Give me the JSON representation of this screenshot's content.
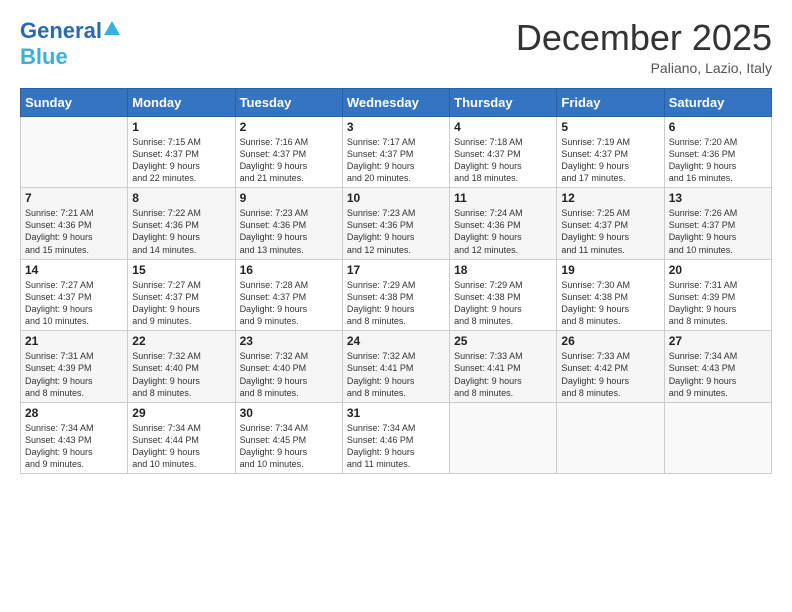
{
  "header": {
    "logo_line1": "General",
    "logo_line2": "Blue",
    "month_title": "December 2025",
    "location": "Paliano, Lazio, Italy"
  },
  "calendar": {
    "days_of_week": [
      "Sunday",
      "Monday",
      "Tuesday",
      "Wednesday",
      "Thursday",
      "Friday",
      "Saturday"
    ],
    "weeks": [
      [
        {
          "day": "",
          "info": ""
        },
        {
          "day": "1",
          "info": "Sunrise: 7:15 AM\nSunset: 4:37 PM\nDaylight: 9 hours\nand 22 minutes."
        },
        {
          "day": "2",
          "info": "Sunrise: 7:16 AM\nSunset: 4:37 PM\nDaylight: 9 hours\nand 21 minutes."
        },
        {
          "day": "3",
          "info": "Sunrise: 7:17 AM\nSunset: 4:37 PM\nDaylight: 9 hours\nand 20 minutes."
        },
        {
          "day": "4",
          "info": "Sunrise: 7:18 AM\nSunset: 4:37 PM\nDaylight: 9 hours\nand 18 minutes."
        },
        {
          "day": "5",
          "info": "Sunrise: 7:19 AM\nSunset: 4:37 PM\nDaylight: 9 hours\nand 17 minutes."
        },
        {
          "day": "6",
          "info": "Sunrise: 7:20 AM\nSunset: 4:36 PM\nDaylight: 9 hours\nand 16 minutes."
        }
      ],
      [
        {
          "day": "7",
          "info": "Sunrise: 7:21 AM\nSunset: 4:36 PM\nDaylight: 9 hours\nand 15 minutes."
        },
        {
          "day": "8",
          "info": "Sunrise: 7:22 AM\nSunset: 4:36 PM\nDaylight: 9 hours\nand 14 minutes."
        },
        {
          "day": "9",
          "info": "Sunrise: 7:23 AM\nSunset: 4:36 PM\nDaylight: 9 hours\nand 13 minutes."
        },
        {
          "day": "10",
          "info": "Sunrise: 7:23 AM\nSunset: 4:36 PM\nDaylight: 9 hours\nand 12 minutes."
        },
        {
          "day": "11",
          "info": "Sunrise: 7:24 AM\nSunset: 4:36 PM\nDaylight: 9 hours\nand 12 minutes."
        },
        {
          "day": "12",
          "info": "Sunrise: 7:25 AM\nSunset: 4:37 PM\nDaylight: 9 hours\nand 11 minutes."
        },
        {
          "day": "13",
          "info": "Sunrise: 7:26 AM\nSunset: 4:37 PM\nDaylight: 9 hours\nand 10 minutes."
        }
      ],
      [
        {
          "day": "14",
          "info": "Sunrise: 7:27 AM\nSunset: 4:37 PM\nDaylight: 9 hours\nand 10 minutes."
        },
        {
          "day": "15",
          "info": "Sunrise: 7:27 AM\nSunset: 4:37 PM\nDaylight: 9 hours\nand 9 minutes."
        },
        {
          "day": "16",
          "info": "Sunrise: 7:28 AM\nSunset: 4:37 PM\nDaylight: 9 hours\nand 9 minutes."
        },
        {
          "day": "17",
          "info": "Sunrise: 7:29 AM\nSunset: 4:38 PM\nDaylight: 9 hours\nand 8 minutes."
        },
        {
          "day": "18",
          "info": "Sunrise: 7:29 AM\nSunset: 4:38 PM\nDaylight: 9 hours\nand 8 minutes."
        },
        {
          "day": "19",
          "info": "Sunrise: 7:30 AM\nSunset: 4:38 PM\nDaylight: 9 hours\nand 8 minutes."
        },
        {
          "day": "20",
          "info": "Sunrise: 7:31 AM\nSunset: 4:39 PM\nDaylight: 9 hours\nand 8 minutes."
        }
      ],
      [
        {
          "day": "21",
          "info": "Sunrise: 7:31 AM\nSunset: 4:39 PM\nDaylight: 9 hours\nand 8 minutes."
        },
        {
          "day": "22",
          "info": "Sunrise: 7:32 AM\nSunset: 4:40 PM\nDaylight: 9 hours\nand 8 minutes."
        },
        {
          "day": "23",
          "info": "Sunrise: 7:32 AM\nSunset: 4:40 PM\nDaylight: 9 hours\nand 8 minutes."
        },
        {
          "day": "24",
          "info": "Sunrise: 7:32 AM\nSunset: 4:41 PM\nDaylight: 9 hours\nand 8 minutes."
        },
        {
          "day": "25",
          "info": "Sunrise: 7:33 AM\nSunset: 4:41 PM\nDaylight: 9 hours\nand 8 minutes."
        },
        {
          "day": "26",
          "info": "Sunrise: 7:33 AM\nSunset: 4:42 PM\nDaylight: 9 hours\nand 8 minutes."
        },
        {
          "day": "27",
          "info": "Sunrise: 7:34 AM\nSunset: 4:43 PM\nDaylight: 9 hours\nand 9 minutes."
        }
      ],
      [
        {
          "day": "28",
          "info": "Sunrise: 7:34 AM\nSunset: 4:43 PM\nDaylight: 9 hours\nand 9 minutes."
        },
        {
          "day": "29",
          "info": "Sunrise: 7:34 AM\nSunset: 4:44 PM\nDaylight: 9 hours\nand 10 minutes."
        },
        {
          "day": "30",
          "info": "Sunrise: 7:34 AM\nSunset: 4:45 PM\nDaylight: 9 hours\nand 10 minutes."
        },
        {
          "day": "31",
          "info": "Sunrise: 7:34 AM\nSunset: 4:46 PM\nDaylight: 9 hours\nand 11 minutes."
        },
        {
          "day": "",
          "info": ""
        },
        {
          "day": "",
          "info": ""
        },
        {
          "day": "",
          "info": ""
        }
      ]
    ]
  }
}
